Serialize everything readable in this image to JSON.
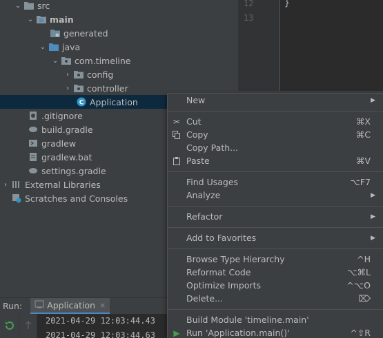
{
  "tree": {
    "src": "src",
    "main": "main",
    "generated": "generated",
    "java": "java",
    "package": "com.timeline",
    "config": "config",
    "controller": "controller",
    "application": "Application",
    "gitignore": ".gitignore",
    "build_gradle": "build.gradle",
    "gradlew": "gradlew",
    "gradlew_bat": "gradlew.bat",
    "settings_gradle": "settings.gradle",
    "external_libraries": "External Libraries",
    "scratches": "Scratches and Consoles"
  },
  "editor": {
    "line_12": "12",
    "line_13": "13",
    "code_line": "}"
  },
  "run": {
    "label": "Run:",
    "tab_label": "Application",
    "tab_close": "×",
    "console_line_1": "2021-04-29 12:03:44.43",
    "console_line_2": "2021-04-29 12:03:44.63"
  },
  "menu": {
    "new": "New",
    "cut": "Cut",
    "cut_sc": "⌘X",
    "copy": "Copy",
    "copy_sc": "⌘C",
    "copy_path": "Copy Path...",
    "paste": "Paste",
    "paste_sc": "⌘V",
    "find_usages": "Find Usages",
    "find_usages_sc": "⌥F7",
    "analyze": "Analyze",
    "refactor": "Refactor",
    "add_to_favorites": "Add to Favorites",
    "browse_type_hierarchy": "Browse Type Hierarchy",
    "browse_type_hierarchy_sc": "^H",
    "reformat_code": "Reformat Code",
    "reformat_code_sc": "⌥⌘L",
    "optimize_imports": "Optimize Imports",
    "optimize_imports_sc": "^⌥O",
    "delete": "Delete...",
    "delete_sc": "⌦",
    "build_module": "Build Module 'timeline.main'",
    "run_app": "Run 'Application.main()'",
    "run_app_sc": "^⇧R"
  },
  "colors": {
    "background": "#3c3f41",
    "selection": "#0d293e",
    "folder": "#87939a",
    "source_folder": "#4e8bbf",
    "class_icon": "#3592c4",
    "run_green": "#499c54"
  }
}
